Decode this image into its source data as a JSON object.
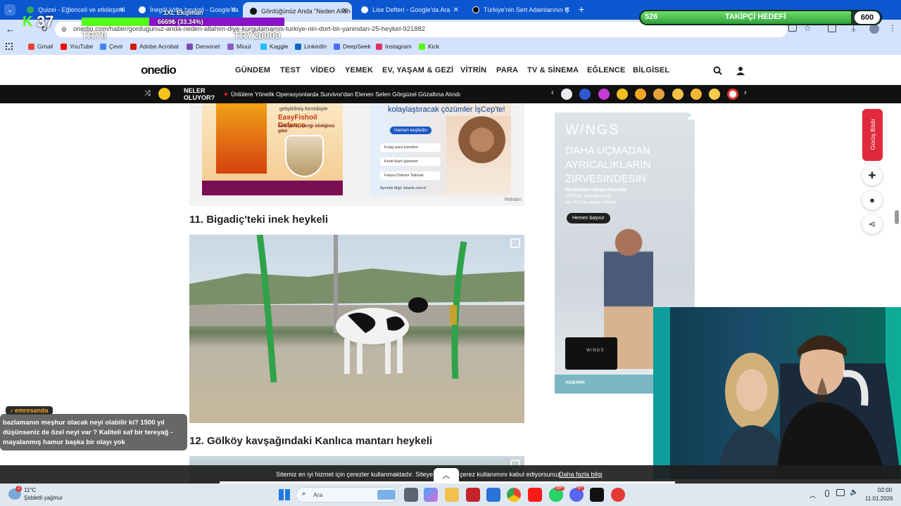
{
  "browser": {
    "tabs": [
      {
        "title": "Quizei - Eğlenceli ve etkileşimli",
        "active": false,
        "color": "#34a853"
      },
      {
        "title": "İnegöl köfte heykeli - Google'da",
        "active": false,
        "color": "#4285f4"
      },
      {
        "title": "Gördüğünüz Anda \"Neden Allah",
        "active": true,
        "color": "#111111"
      },
      {
        "title": "Lise Defteri - Google'da Ara",
        "active": false,
        "color": "#4285f4"
      },
      {
        "title": "Türkiye'nin Sert Adamlarının Ç",
        "active": false,
        "color": "#000000"
      }
    ],
    "url": "onedio.com/haber/gordugunuz-anda-neden-allahim-diye-kurgulamamis-turkiye-nin-dort-bir-yanindan-25-heykel-921882",
    "bookmarks": [
      "Gmail",
      "YouTube",
      "Çevir",
      "Adobe Acrobat",
      "Dersonet",
      "Miuul",
      "Kaggle",
      "LinkedIn",
      "DeepSeek",
      "Instagram",
      "Kick"
    ]
  },
  "stream_overlay": {
    "kick_number": "37",
    "goal_label": "1XL Ekipman",
    "goal_progress_text": "6669₺ (33.34%)",
    "goal_fraction": 0.3334,
    "try_left": "TRY0",
    "try_right": "TRY20000",
    "follower_current": "526",
    "follower_label": "TAKİPÇİ HEDEFİ",
    "follower_target": "600",
    "follower_fraction": 0.877,
    "chat_user": "emresanda",
    "chat_message": "bazlamanın meşhur olacak neyi olabilir ki? 1500 yıl düşünseniz de özel neyi var ? Kaliteli saf bir tereyağ - mayalanmış hamur başka bir olayı yok"
  },
  "site": {
    "logo": "onedio",
    "nav": [
      "GÜNDEM",
      "TEST",
      "VİDEO",
      "YEMEK",
      "EV, YAŞAM & GEZİ",
      "VİTRİN",
      "PARA",
      "TV & SİNEMA",
      "EĞLENCE",
      "BİLGİSEL"
    ],
    "ticker_label_1": "NELER",
    "ticker_label_2": "OLUYOR?",
    "ticker_headline": "Ünlülere Yönelik Operasyonlarda Survivor'dan Elenen Selen Görgüzel Gözaltına Alındı",
    "feedback": "Görüş Bildir",
    "ad_label": "Reklam",
    "ad1": {
      "line1": "geliştirilmiş formülüyle",
      "brand": "EasyFishoil Defence",
      "tagline": "İsmi yeni, içeriği bildiğiniz gibi!"
    },
    "ad2": {
      "headline": "kolaylaştıracak çözümler İşCep'te!",
      "cta": "Hemen keşfedin",
      "items": [
        "Kolay para transferi",
        "Kredi Kartı işlemleri",
        "Fatura Ödeme Talimatı"
      ],
      "footer": "Ayrıntılı bilgi: isbank.com.tr"
    },
    "ad3": {
      "brand": "W/NGS",
      "headline": "DAHA UÇMADAN AYRICALIKLARIN ZİRVESİNDESİN",
      "detail1": "Havalimanı otoparklarında",
      "detail2": "%50'ye, transferlerde",
      "detail3": "ise %75'e varan indirim.",
      "cta": "Hemen başvur",
      "card_brand": "W/NGS",
      "bank": "AKBANK"
    },
    "heading_11": "11. Bigadiç'teki inek heykeli",
    "heading_12": "12. Gölköy kavşağındaki Kanlıca mantarı heykeli",
    "cookie_pre": "Sitemiz en iyi hizmet için çerezler kullanmaktadır. Siteye gir",
    "cookie_post": "çerez kullanımını kabul ediyorsunuz.",
    "cookie_link": "Daha fazla bilgi"
  },
  "taskbar": {
    "weather_temp": "11°C",
    "weather_desc": "Şiddetli yağmur",
    "search": "Ara",
    "time": "02:00",
    "date": "11.01.2026",
    "badge_whatsapp": "99+",
    "badge_discord": "9+",
    "badge_weather": "2"
  }
}
